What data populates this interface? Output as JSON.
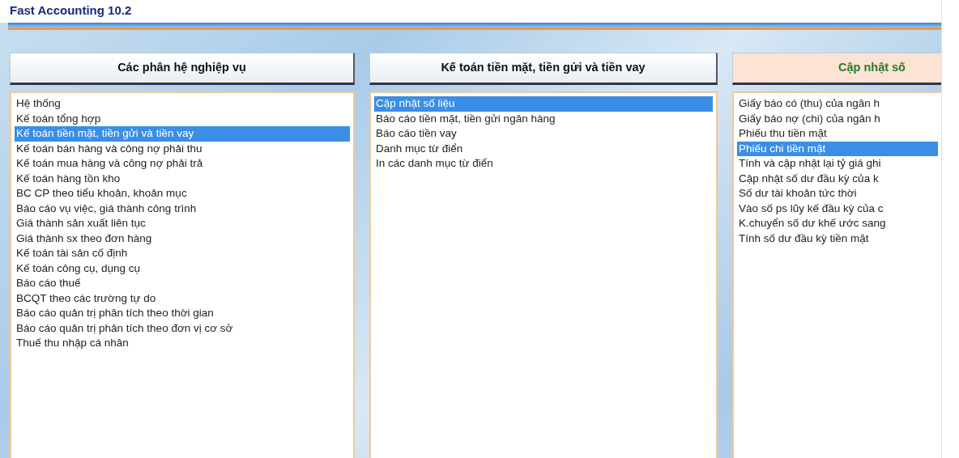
{
  "window": {
    "title": "Fast Accounting 10.2"
  },
  "panels": [
    {
      "header": "Các phân hệ nghiệp vụ",
      "active": false,
      "items": [
        {
          "label": "Hệ thống",
          "selected": false
        },
        {
          "label": "Kế toán tổng hợp",
          "selected": false
        },
        {
          "label": "Kế toán tiền mặt, tiền gửi và tiền vay",
          "selected": true
        },
        {
          "label": "Kế toán bán hàng và công nợ phải thu",
          "selected": false
        },
        {
          "label": "Kế toán mua hàng và công nợ phải trả",
          "selected": false
        },
        {
          "label": "Kế toán hàng tồn kho",
          "selected": false
        },
        {
          "label": "BC CP theo tiểu khoản, khoản mục",
          "selected": false
        },
        {
          "label": "Báo cáo vụ việc, giá thành công trình",
          "selected": false
        },
        {
          "label": "Giá thành sản xuất liên tục",
          "selected": false
        },
        {
          "label": "Giá thành sx theo đơn hàng",
          "selected": false
        },
        {
          "label": "Kế toán tài sản cố định",
          "selected": false
        },
        {
          "label": "Kế toán công cụ, dụng cụ",
          "selected": false
        },
        {
          "label": "Báo cáo thuế",
          "selected": false
        },
        {
          "label": "BCQT theo các trường tự do",
          "selected": false
        },
        {
          "label": "Báo cáo quản trị phân tích theo thời gian",
          "selected": false
        },
        {
          "label": "Báo cáo quản trị phân tích theo đơn vị cơ sở",
          "selected": false
        },
        {
          "label": "Thuế thu nhập cá nhân",
          "selected": false
        }
      ]
    },
    {
      "header": "Kế toán tiền mặt, tiền gửi và tiền vay",
      "active": false,
      "items": [
        {
          "label": "Cập nhật số liệu",
          "selected": true
        },
        {
          "label": "Báo cáo tiền mặt, tiền gửi ngân hàng",
          "selected": false
        },
        {
          "label": "Báo cáo tiền vay",
          "selected": false
        },
        {
          "label": "Danh mục từ điển",
          "selected": false
        },
        {
          "label": "In các danh mục từ điển",
          "selected": false
        }
      ]
    },
    {
      "header": "Cập nhật số",
      "active": true,
      "items": [
        {
          "label": "Giấy báo có (thu) của ngân h",
          "selected": false
        },
        {
          "label": "Giấy báo nợ (chi) của ngân h",
          "selected": false
        },
        {
          "label": "Phiếu thu tiền mặt",
          "selected": false
        },
        {
          "label": "Phiếu chi tiền mặt",
          "selected": true
        },
        {
          "label": "Tính và cập nhật lại tỷ giá ghi",
          "selected": false
        },
        {
          "label": "Cập nhật số dư đầu kỳ của k",
          "selected": false
        },
        {
          "label": "Số dư tài khoản tức thời",
          "selected": false
        },
        {
          "label": "Vào số ps lũy kế đầu kỳ của c",
          "selected": false
        },
        {
          "label": "K.chuyển số dư khế ước sang",
          "selected": false
        },
        {
          "label": "Tính số dư đầu kỳ tiền mặt",
          "selected": false
        }
      ]
    }
  ]
}
